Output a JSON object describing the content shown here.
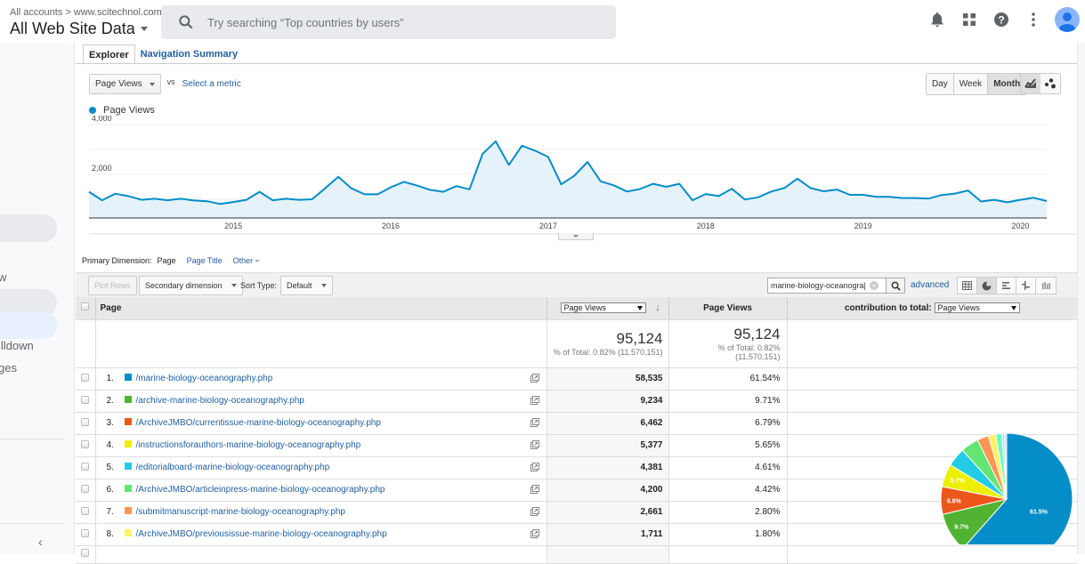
{
  "header": {
    "breadcrumb": [
      "All accounts",
      "www.scitechnol.com"
    ],
    "breadcrumb_separator": ">",
    "view_title": "All Web Site Data",
    "search_placeholder": "Try searching “Top countries by users”",
    "icons": [
      "notifications-icon",
      "apps-icon",
      "help-icon",
      "more-vert-icon",
      "account-avatar"
    ]
  },
  "sidebar": {
    "items": [
      {
        "label": "w"
      },
      {
        "label": "illdown"
      },
      {
        "label": "ges"
      }
    ],
    "collapse_icon": "‹"
  },
  "tabs": [
    {
      "label": "Explorer",
      "active": true
    },
    {
      "label": "Navigation Summary",
      "active": false
    }
  ],
  "metric_selector": {
    "value": "Page Views",
    "vs_label": "vs",
    "compare_link": "Select a metric"
  },
  "granularity": {
    "options": [
      "Day",
      "Week",
      "Month"
    ],
    "selected": "Month"
  },
  "chart_type_buttons": [
    "line-chart-icon",
    "motion-chart-icon"
  ],
  "chart_data": {
    "type": "area",
    "title": "",
    "legend": [
      "Page Views"
    ],
    "legend_position": "top-left",
    "series_color": "#058dc7",
    "fill_color": "#e5f2f9",
    "xlabel": "",
    "ylabel": "",
    "y_ticks": [
      "4,000",
      "2,000"
    ],
    "y_tick_values": [
      4000,
      2000
    ],
    "ylim": [
      0,
      4000
    ],
    "x_tick_labels": [
      "2015",
      "2016",
      "2017",
      "2018",
      "2019",
      "2020"
    ],
    "x_start": "2014-02",
    "x_end": "2020-03",
    "granularity": "month",
    "series": [
      {
        "name": "Page Views",
        "values": [
          1300,
          960,
          1220,
          1130,
          980,
          1020,
          960,
          1020,
          950,
          920,
          810,
          890,
          980,
          1300,
          960,
          1020,
          980,
          1000,
          1440,
          1900,
          1440,
          1200,
          1200,
          1480,
          1700,
          1550,
          1380,
          1300,
          1530,
          1400,
          2820,
          3330,
          2380,
          3150,
          2950,
          2700,
          1600,
          1950,
          2500,
          1720,
          1560,
          1310,
          1410,
          1620,
          1500,
          1620,
          960,
          1210,
          1130,
          1420,
          990,
          1080,
          1310,
          1450,
          1830,
          1450,
          1320,
          1390,
          1180,
          1180,
          1100,
          1100,
          1050,
          1050,
          1030,
          1170,
          1230,
          1350,
          910,
          980,
          880,
          980,
          1060,
          930
        ]
      }
    ]
  },
  "primary_dimension": {
    "label": "Primary Dimension:",
    "selected": "Page",
    "options": [
      "Page Title",
      "Other"
    ]
  },
  "toolbar": {
    "plot_rows": "Plot Rows",
    "secondary_dimension": "Secondary dimension",
    "sort_type_label": "Sort Type:",
    "sort_type_value": "Default",
    "filter_value": "marine-biology-oceanogra|",
    "advanced": "advanced",
    "view_icons": [
      "data-table-icon",
      "percentage-pie-icon",
      "performance-bars-icon",
      "comparison-icon",
      "term-cloud-icon"
    ],
    "active_view": "percentage-pie-icon"
  },
  "table": {
    "columns": {
      "page": "Page",
      "metric_select": "Page Views",
      "metric": "Page Views",
      "contribution_label": "contribution to total:",
      "contribution_select": "Page Views"
    },
    "totals": {
      "value1": "95,124",
      "sub1": "% of Total: 0.82% (11,570,151)",
      "value2": "95,124",
      "sub2_line1": "% of Total: 0.82%",
      "sub2_line2": "(11,570,151)"
    },
    "rows": [
      {
        "num": "1.",
        "page": "/marine-biology-oceanography.php",
        "views": "58,535",
        "pct": "61.54%",
        "color": "#058dc7"
      },
      {
        "num": "2.",
        "page": "/archive-marine-biology-oceanography.php",
        "views": "9,234",
        "pct": "9.71%",
        "color": "#50b432"
      },
      {
        "num": "3.",
        "page": "/ArchiveJMBO/currentissue-marine-biology-oceanography.php",
        "views": "6,462",
        "pct": "6.79%",
        "color": "#ed561b"
      },
      {
        "num": "4.",
        "page": "/instructionsforauthors-marine-biology-oceanography.php",
        "views": "5,377",
        "pct": "5.65%",
        "color": "#edef00"
      },
      {
        "num": "5.",
        "page": "/editorialboard-marine-biology-oceanography.php",
        "views": "4,381",
        "pct": "4.61%",
        "color": "#24cbe5"
      },
      {
        "num": "6.",
        "page": "/ArchiveJMBO/articleinpress-marine-biology-oceanography.php",
        "views": "4,200",
        "pct": "4.42%",
        "color": "#64e572"
      },
      {
        "num": "7.",
        "page": "/submitmanuscript-marine-biology-oceanography.php",
        "views": "2,661",
        "pct": "2.80%",
        "color": "#ff9655"
      },
      {
        "num": "8.",
        "page": "/ArchiveJMBO/previousissue-marine-biology-oceanography.php",
        "views": "1,711",
        "pct": "1.80%",
        "color": "#fff263"
      }
    ]
  },
  "pie": {
    "slices": [
      {
        "value": 61.54,
        "label": "61.5%",
        "color": "#058dc7"
      },
      {
        "value": 9.71,
        "label": "9.7%",
        "color": "#50b432"
      },
      {
        "value": 6.79,
        "label": "6.8%",
        "color": "#ed561b"
      },
      {
        "value": 5.65,
        "label": "5.7%",
        "color": "#edef00"
      },
      {
        "value": 4.61,
        "label": "",
        "color": "#24cbe5"
      },
      {
        "value": 4.42,
        "label": "",
        "color": "#64e572"
      },
      {
        "value": 2.8,
        "label": "",
        "color": "#ff9655"
      },
      {
        "value": 1.8,
        "label": "",
        "color": "#fff263"
      },
      {
        "value": 1.5,
        "label": "",
        "color": "#6af9c4"
      },
      {
        "value": 0.7,
        "label": "",
        "color": "#b2deff"
      },
      {
        "value": 0.48,
        "label": "",
        "color": "#cccccc"
      }
    ]
  }
}
